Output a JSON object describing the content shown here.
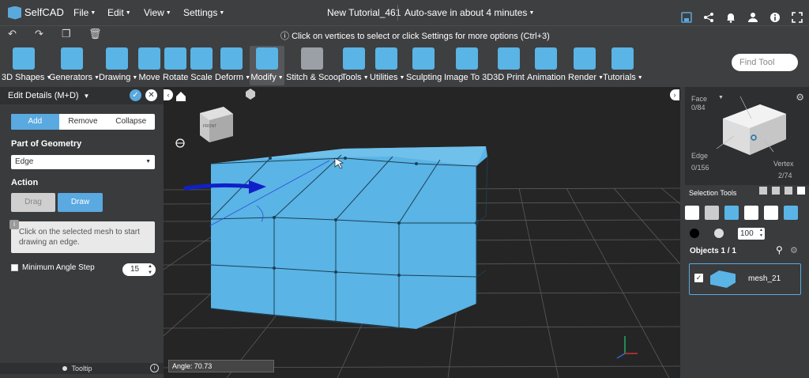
{
  "app": {
    "brand": "SelfCAD",
    "doc_title": "New Tutorial_461",
    "autosave": "Auto-save in about 4 minutes"
  },
  "menus": [
    "File",
    "Edit",
    "View",
    "Settings"
  ],
  "hint": "Click on vertices to select or click Settings for more options (Ctrl+3)",
  "ribbon": [
    {
      "label": "3D Shapes",
      "caret": true
    },
    {
      "label": "Generators",
      "caret": true
    },
    {
      "label": "Drawing",
      "caret": true
    },
    {
      "label": "Move",
      "caret": false
    },
    {
      "label": "Rotate",
      "caret": false
    },
    {
      "label": "Scale",
      "caret": false
    },
    {
      "label": "Deform",
      "caret": true
    },
    {
      "label": "Modify",
      "caret": true
    },
    {
      "label": "Stitch & Scoop",
      "caret": false
    },
    {
      "label": "Tools",
      "caret": true
    },
    {
      "label": "Utilities",
      "caret": true
    },
    {
      "label": "Sculpting",
      "caret": false
    },
    {
      "label": "Image To 3D",
      "caret": false
    },
    {
      "label": "3D Print",
      "caret": false
    },
    {
      "label": "Animation",
      "caret": false
    },
    {
      "label": "Render",
      "caret": true
    },
    {
      "label": "Tutorials",
      "caret": true
    }
  ],
  "find_tool_placeholder": "Find Tool",
  "left_panel": {
    "title": "Edit Details (M+D)",
    "mode_buttons": [
      "Add",
      "Remove",
      "Collapse"
    ],
    "part_label": "Part of Geometry",
    "part_value": "Edge",
    "action_label": "Action",
    "action_buttons": [
      "Drag",
      "Draw"
    ],
    "tip_icon": "i",
    "tip_text": "Click on the selected mesh to start drawing an edge.",
    "angle_label": "Minimum Angle Step",
    "angle_value": "15",
    "footer": "Tooltip"
  },
  "viewport": {
    "angle_label": "Angle:",
    "angle_value": "70.73",
    "cube_label": "FRONT"
  },
  "right_panel": {
    "face_label": "Face",
    "face_count": "0/84",
    "edge_label": "Edge",
    "edge_count": "0/156",
    "vertex_label": "Vertex",
    "vertex_count": "2/74",
    "selection_tools": "Selection Tools",
    "percent": "100",
    "objects_header": "Objects 1 / 1",
    "object_name": "mesh_21"
  },
  "colors": {
    "accent": "#5aa9e0",
    "mesh": "#5ab4e5",
    "arrow": "#1020c8",
    "bg": "#3e3f41"
  }
}
